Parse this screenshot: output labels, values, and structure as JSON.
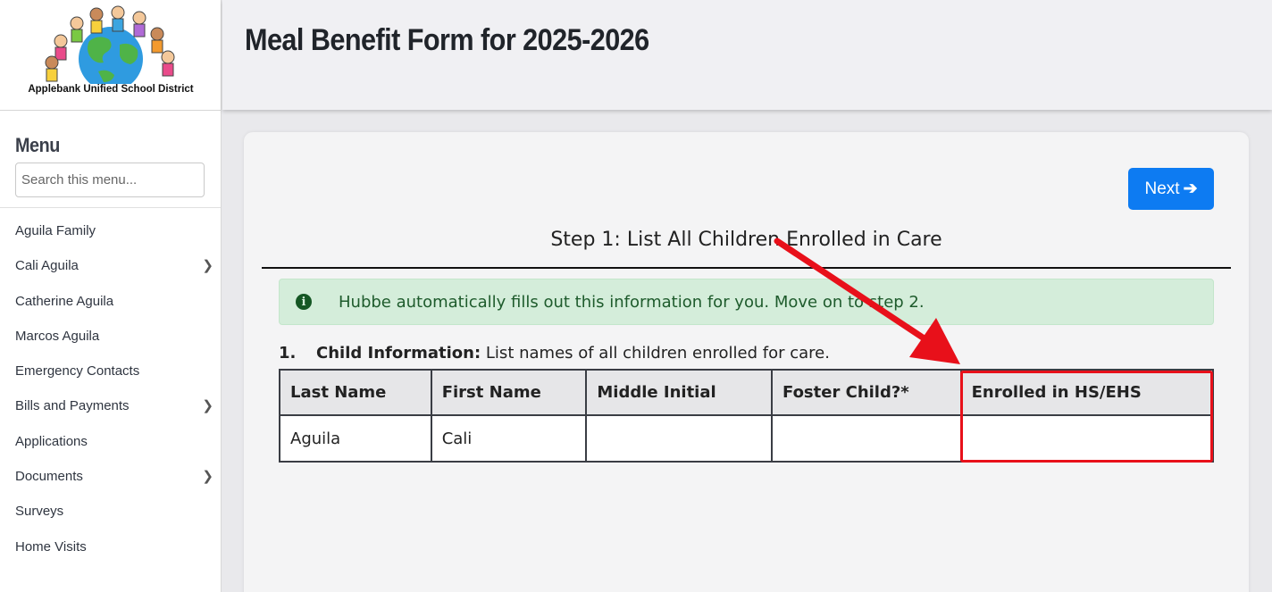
{
  "org": {
    "name": "Applebank Unified School District"
  },
  "sidebar": {
    "menu_title": "Menu",
    "search_placeholder": "Search this menu...",
    "items": [
      {
        "label": "Aguila Family",
        "has_submenu": false
      },
      {
        "label": "Cali Aguila",
        "has_submenu": true
      },
      {
        "label": "Catherine Aguila",
        "has_submenu": false
      },
      {
        "label": "Marcos Aguila",
        "has_submenu": false
      },
      {
        "label": "Emergency Contacts",
        "has_submenu": false
      },
      {
        "label": "Bills and Payments",
        "has_submenu": true
      },
      {
        "label": "Applications",
        "has_submenu": false
      },
      {
        "label": "Documents",
        "has_submenu": true
      },
      {
        "label": "Surveys",
        "has_submenu": false
      },
      {
        "label": "Home Visits",
        "has_submenu": false
      }
    ]
  },
  "header": {
    "title": "Meal Benefit Form for 2025-2026"
  },
  "main": {
    "next_label": "Next",
    "next_icon": "arrow-right-icon",
    "step_title": "Step 1: List All Children Enrolled in Care",
    "alert": {
      "icon": "info-circle-icon",
      "text": "Hubbe automatically fills out this information for you. Move on to step 2."
    },
    "section": {
      "number": "1.",
      "label": "Child Information:",
      "description": "List names of all children enrolled for care."
    },
    "table": {
      "columns": [
        "Last Name",
        "First Name",
        "Middle Initial",
        "Foster Child?*",
        "Enrolled in HS/EHS"
      ],
      "rows": [
        [
          "Aguila",
          "Cali",
          "",
          "",
          ""
        ]
      ]
    }
  },
  "annotation": {
    "color": "#e8101a",
    "highlighted_column": "Enrolled in HS/EHS"
  },
  "colors": {
    "primary_button": "#0d7bf2",
    "alert_bg": "#d4edda",
    "alert_text": "#1e5b2c"
  }
}
